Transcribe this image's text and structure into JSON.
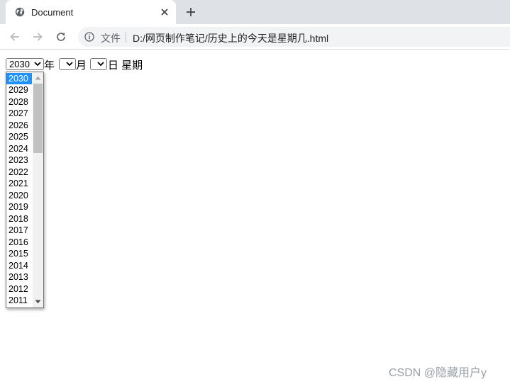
{
  "browser": {
    "tab": {
      "title": "Document"
    },
    "address_bar": {
      "scheme_label": "文件",
      "url": "D:/网页制作笔记/历史上的今天是星期几.html"
    }
  },
  "page": {
    "year_select": {
      "value": "2030"
    },
    "year_label": "年",
    "month_select": {
      "value": ""
    },
    "month_label": "月",
    "day_select": {
      "value": ""
    },
    "day_label": "日 星期",
    "year_options": [
      "2030",
      "2029",
      "2028",
      "2027",
      "2026",
      "2025",
      "2024",
      "2023",
      "2022",
      "2021",
      "2020",
      "2019",
      "2018",
      "2017",
      "2016",
      "2015",
      "2014",
      "2013",
      "2012",
      "2011"
    ],
    "selected_year_index": 0
  },
  "watermark": "CSDN @隐藏用户y",
  "colors": {
    "selection": "#1e90ff",
    "tabstrip": "#dee1e6",
    "omnibox": "#f1f3f4"
  },
  "icons": {
    "favicon": "globe-icon",
    "close": "close-icon",
    "new_tab": "plus-icon",
    "back": "back-arrow-icon",
    "forward": "forward-arrow-icon",
    "reload": "reload-icon",
    "info": "info-icon"
  }
}
